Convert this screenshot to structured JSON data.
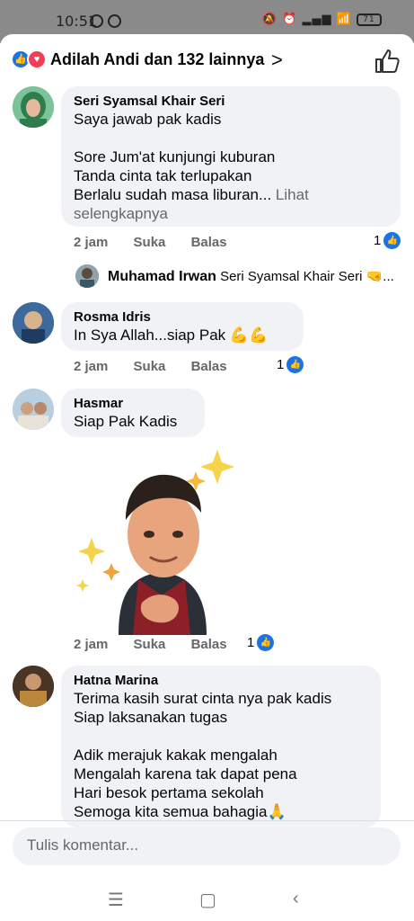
{
  "status_bar": {
    "time": "10:51",
    "battery": "71"
  },
  "header": {
    "reactions_text": "Adilah Andi dan 132 lainnya"
  },
  "comments": [
    {
      "name": "Seri Syamsal Khair Seri",
      "text": "Saya jawab pak kadis\n\nSore Jum'at kunjungi kuburan\nTanda cinta tak terlupakan\nBerlalu sudah masa liburan...",
      "see_more": "Lihat selengkapnya",
      "time": "2 jam",
      "like_label": "Suka",
      "reply_label": "Balas",
      "likes": "1",
      "reply": {
        "name": "Muhamad Irwan",
        "text": "Seri Syamsal Khair Seri 🤜..."
      }
    },
    {
      "name": "Rosma Idris",
      "text": "In Sya Allah...siap Pak 💪💪",
      "time": "2 jam",
      "like_label": "Suka",
      "reply_label": "Balas",
      "likes": "1"
    },
    {
      "name": "Hasmar",
      "text": "Siap Pak Kadis",
      "time": "2 jam",
      "like_label": "Suka",
      "reply_label": "Balas",
      "likes": "1"
    },
    {
      "name": "Hatna Marina",
      "text": "Terima kasih surat cinta nya pak kadis\nSiap laksanakan tugas\n\nAdik merajuk kakak mengalah\nMengalah karena tak dapat pena\nHari besok pertama sekolah\nSemoga kita semua bahagia🙏"
    }
  ],
  "composer": {
    "placeholder": "Tulis komentar..."
  }
}
